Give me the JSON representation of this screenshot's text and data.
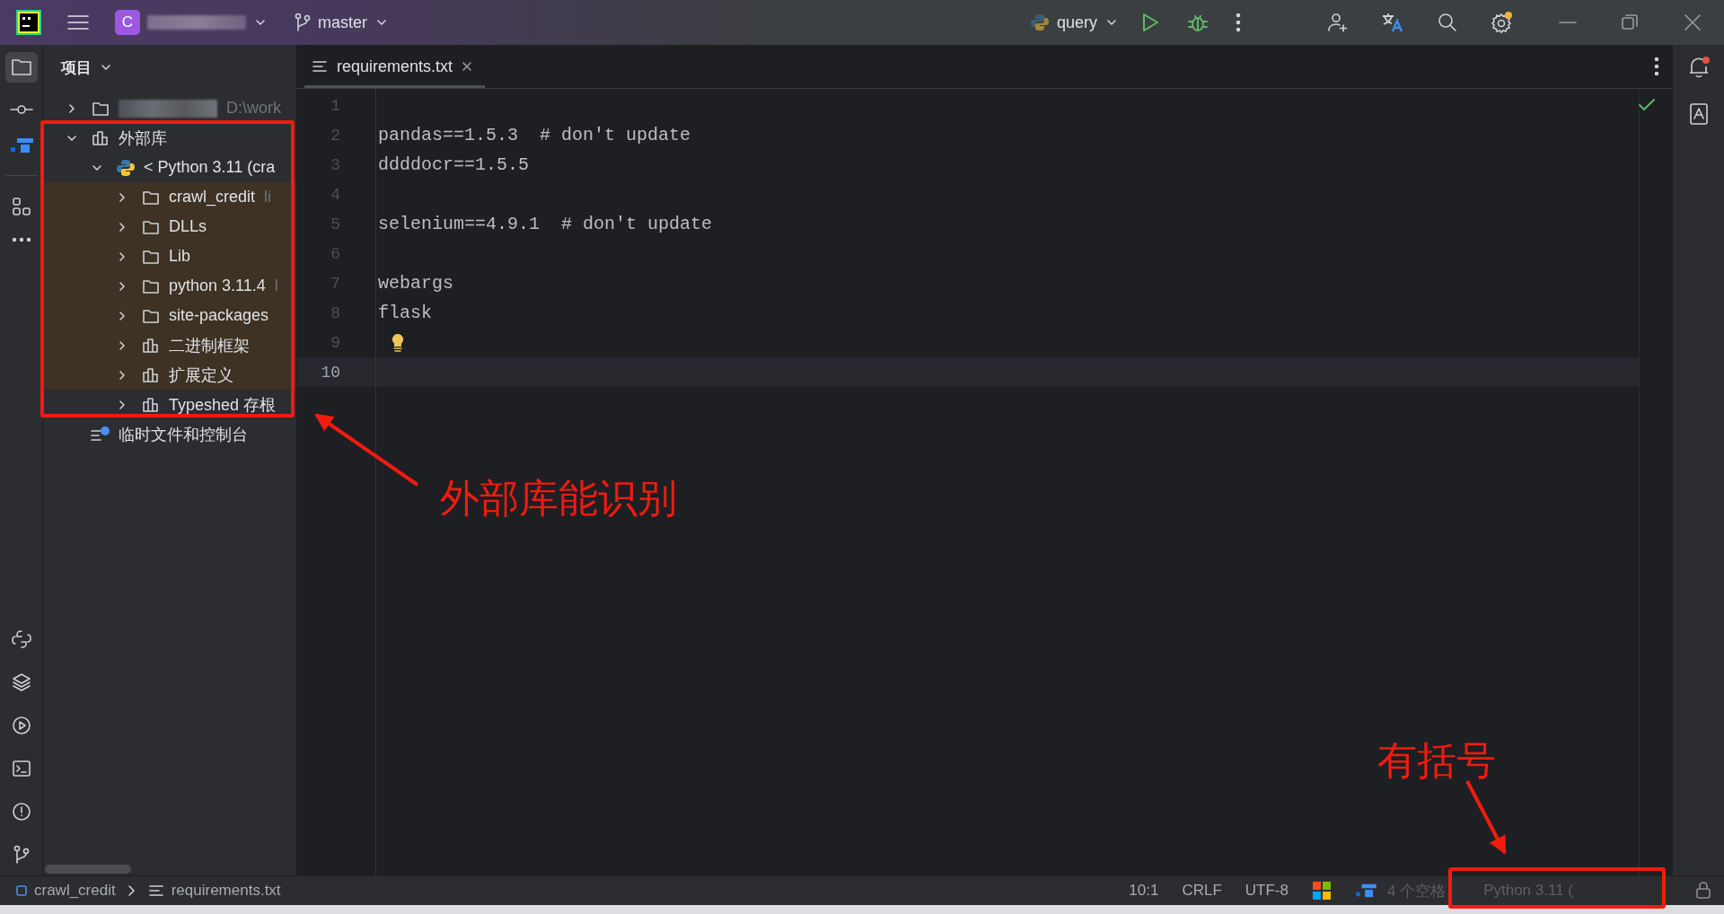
{
  "title_bar": {
    "project_initial": "C",
    "branch": "master",
    "run_config": "query"
  },
  "project_panel": {
    "title": "项目",
    "tree": [
      {
        "hint": "D:\\work",
        "kind": "folder",
        "expanded": false,
        "highlighted": false
      },
      {
        "label": "外部库",
        "kind": "library",
        "expanded": true,
        "highlighted": false,
        "children": [
          {
            "label": "< Python 3.11 (cra",
            "kind": "python",
            "expanded": true,
            "highlighted": false,
            "children": [
              {
                "label": "crawl_credit",
                "hint": "li",
                "kind": "folder",
                "expanded": false,
                "highlighted": true
              },
              {
                "label": "DLLs",
                "kind": "folder",
                "expanded": false,
                "highlighted": true
              },
              {
                "label": "Lib",
                "kind": "folder",
                "expanded": false,
                "highlighted": true
              },
              {
                "label": "python 3.11.4",
                "hint": "l",
                "kind": "folder",
                "expanded": false,
                "highlighted": true
              },
              {
                "label": "site-packages",
                "kind": "folder",
                "expanded": false,
                "highlighted": true
              },
              {
                "label": "二进制框架",
                "kind": "library",
                "expanded": false,
                "highlighted": true
              },
              {
                "label": "扩展定义",
                "kind": "library",
                "expanded": false,
                "highlighted": true
              },
              {
                "label": "Typeshed 存根",
                "kind": "library",
                "expanded": false,
                "highlighted": false
              }
            ]
          }
        ]
      },
      {
        "label": "临时文件和控制台",
        "kind": "scratch",
        "highlighted": false
      }
    ]
  },
  "tabs": [
    {
      "label": "requirements.txt",
      "selected": true
    }
  ],
  "editor": {
    "lines": [
      {
        "number": "1",
        "current": false
      },
      {
        "number": "2",
        "text": "pandas==1.5.3  # don't update",
        "current": false
      },
      {
        "number": "3",
        "text": "ddddocr==1.5.5",
        "current": false
      },
      {
        "number": "4",
        "current": false
      },
      {
        "number": "5",
        "text": "selenium==4.9.1  # don't update",
        "current": false
      },
      {
        "number": "6",
        "current": false
      },
      {
        "number": "7",
        "text": "webargs",
        "current": false
      },
      {
        "number": "8",
        "text": "flask",
        "current": false
      },
      {
        "number": "9",
        "current": false,
        "bulb": true
      },
      {
        "number": "10",
        "current": true
      }
    ]
  },
  "status_bar": {
    "breadcrumbs": [
      "crawl_credit",
      "requirements.txt"
    ],
    "items": [
      "10:1",
      "CRLF",
      "UTF-8"
    ],
    "indent": "4 个空格",
    "interpreter": "Python 3.11 ("
  },
  "annotations": [
    {
      "kind": "box"
    },
    {
      "kind": "arrow"
    },
    {
      "kind": "text",
      "text": "外部库能识别"
    },
    {
      "kind": "text",
      "text": "有括号"
    },
    {
      "kind": "arrow"
    },
    {
      "kind": "box"
    }
  ]
}
